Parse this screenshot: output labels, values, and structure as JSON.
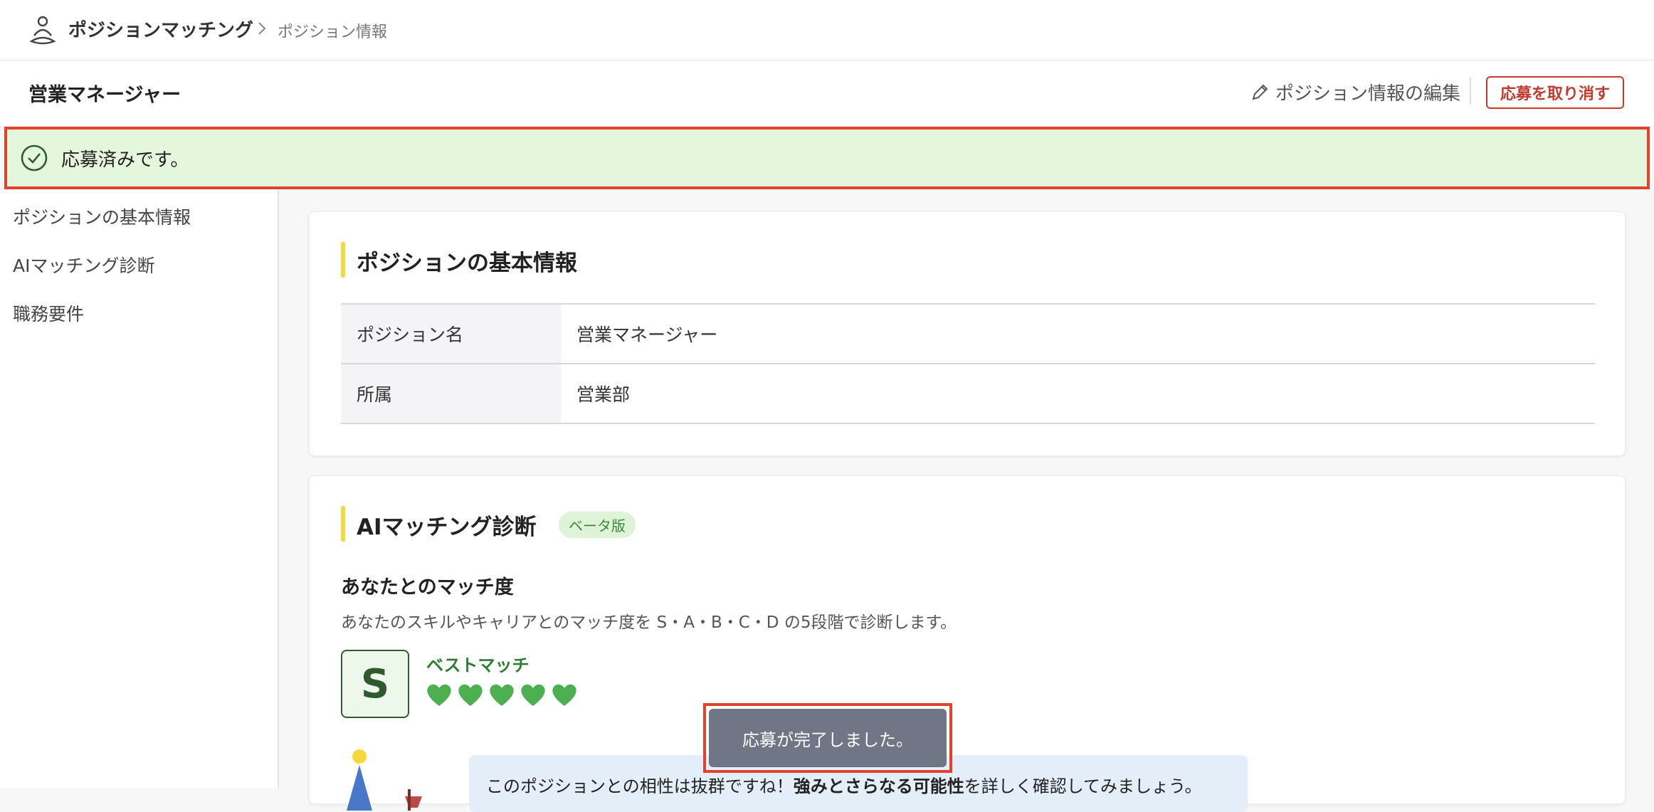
{
  "header": {
    "app_name": "ポジションマッチング",
    "breadcrumb_current": "ポジション情報"
  },
  "position_header": {
    "title": "営業マネージャー",
    "edit_label": "ポジション情報の編集",
    "cancel_label": "応募を取り消す"
  },
  "banner": {
    "text": "応募済みです。"
  },
  "sidebar": {
    "items": [
      {
        "label": "ポジションの基本情報"
      },
      {
        "label": "AIマッチング診断"
      },
      {
        "label": "職務要件"
      }
    ]
  },
  "basic_info": {
    "title": "ポジションの基本情報",
    "rows": [
      {
        "label": "ポジション名",
        "value": "営業マネージャー"
      },
      {
        "label": "所属",
        "value": "営業部"
      }
    ]
  },
  "ai_matching": {
    "title": "AIマッチング診断",
    "badge": "ベータ版",
    "subtitle": "あなたとのマッチ度",
    "description": "あなたのスキルやキャリアとのマッチ度を S・A・B・C・D の5段階で診断します。",
    "grade": "S",
    "grade_label": "ベストマッチ",
    "hearts_filled": 5,
    "hearts_total": 5,
    "speech_part1": "このポジションとの相性は抜群ですね！",
    "speech_bold": "強みとさらなる可能性",
    "speech_part2": "を詳しく確認してみましょう。"
  },
  "toast": {
    "text": "応募が完了しました。"
  },
  "colors": {
    "banner_bg": "#e4f7dd",
    "highlight_border": "#e0432c",
    "danger": "#c23b2e",
    "heart": "#4caf50",
    "accent_bar": "#f5d83b"
  }
}
